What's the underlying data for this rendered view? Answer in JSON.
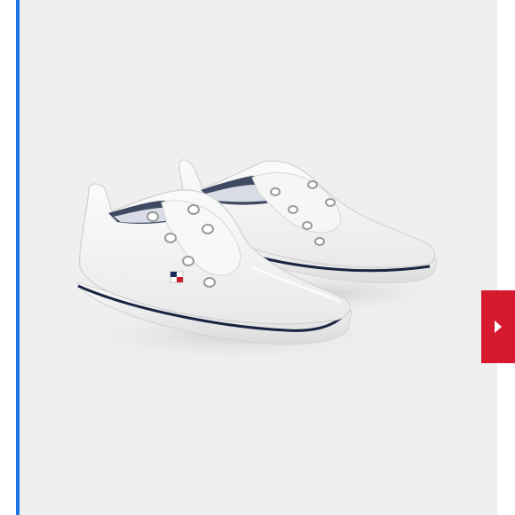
{
  "product": {
    "image_icon": "white-slip-on-sneakers-pair",
    "colors": {
      "panel_background": "#efefef",
      "shoe": "#f7f7f7",
      "sole_stripe": "#1a2340",
      "flag_red": "#cc1f2f",
      "flag_navy": "#1a2a5a"
    }
  },
  "carousel": {
    "next_icon": "chevron-right-icon",
    "button_color": "#d7192f",
    "focus_indicator_color": "#1f73e8"
  }
}
